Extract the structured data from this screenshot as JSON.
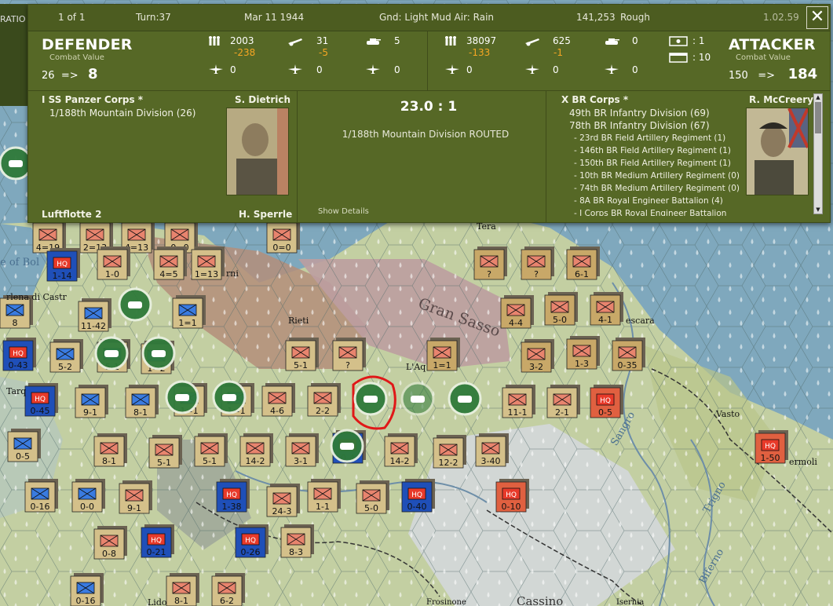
{
  "topbar": {
    "page": "1 of 1",
    "turn": "Turn:37",
    "date": "Mar 11 1944",
    "weather": "Gnd: Light Mud  Air: Rain",
    "hex_info": "141,253",
    "terrain": "Rough",
    "version": "1.02.59",
    "left_label": "RATIO"
  },
  "defender": {
    "title": "DEFENDER",
    "cv_label": "Combat Value",
    "cv_from": "26",
    "cv_arrow": "=>",
    "cv_to": "8",
    "men": "2003",
    "men_loss": "-238",
    "guns": "31",
    "guns_loss": "-5",
    "afv": "5",
    "air1": "0",
    "air2": "0",
    "air3": "0"
  },
  "attacker": {
    "title": "ATTACKER",
    "cv_label": "Combat Value",
    "cv_from": "150",
    "cv_arrow": "=>",
    "cv_to": "184",
    "men": "38097",
    "men_loss": "-133",
    "guns": "625",
    "guns_loss": "-1",
    "afv": "0",
    "air1": "0",
    "air2": "0",
    "air3": "0"
  },
  "modifiers": {
    "m1": ": 1",
    "m2": ": 10"
  },
  "battle": {
    "ratio": "23.0 : 1",
    "result": "1/188th Mountain Division ROUTED",
    "show_details": "Show Details"
  },
  "defender_side": {
    "corps": "I SS Panzer Corps *",
    "leader": "S. Dietrich",
    "units": [
      "1/188th Mountain Division (26)"
    ],
    "air": "Luftflotte 2",
    "air_leader": "H. Sperrle"
  },
  "attacker_side": {
    "corps": "X BR Corps *",
    "leader": "R. McCreery",
    "divisions": [
      "49th BR Infantry Division (69)",
      "78th BR Infantry Division (67)"
    ],
    "support": [
      "- 23rd BR Field Artillery Regiment (1)",
      "- 146th BR Field Artillery Regiment (1)",
      "- 150th BR Field Artillery Regiment (1)",
      "- 10th BR Medium Artillery Regiment (0)",
      "- 74th BR Medium Artillery Regiment (0)",
      "- 8A BR Royal Engineer Battalion (4)",
      "- I Corps BR Royal Engineer Battalion"
    ]
  },
  "map_labels": {
    "rieti": "Rieti",
    "gran_sasso": "Gran Sasso",
    "laq": "L'Aq",
    "pescara": "escara",
    "vasto": "Vasto",
    "termoli": "ermoli",
    "cassino": "Cassino",
    "frosinone": "Frosinone",
    "isernia": "Isernia",
    "sangro": "Sangro",
    "trigno": "Trigno",
    "biferno": "Biferno",
    "bolsena": "e of Bol",
    "orlena": "rlena di Castr",
    "tera": "Tera",
    "tarq": "Tarq",
    "rni": "rni",
    "lido": "Lido"
  },
  "units": [
    {
      "t": "x",
      "n": "4=19"
    },
    {
      "t": "x",
      "n": "2=13"
    },
    {
      "t": "x",
      "n": "4=13"
    },
    {
      "t": "x",
      "n": "0=0"
    },
    {
      "t": "x",
      "n": "0=0"
    },
    {
      "t": "hq",
      "n": "1-14"
    },
    {
      "t": "x",
      "n": "1-0"
    },
    {
      "t": "x",
      "n": "4=5"
    },
    {
      "t": "x",
      "n": "1=13"
    },
    {
      "t": "x",
      "n": "11-42"
    },
    {
      "t": "x",
      "n": "1=1"
    },
    {
      "t": "x",
      "n": "8"
    },
    {
      "t": "hq",
      "n": "0-43"
    },
    {
      "t": "x",
      "n": "5-2"
    },
    {
      "t": "x",
      "n": "5-1"
    },
    {
      "t": "x",
      "n": "1=2"
    },
    {
      "t": "x",
      "n": "5-1"
    },
    {
      "t": "x",
      "n": "?"
    },
    {
      "t": "x",
      "n": "1=1"
    },
    {
      "t": "hq",
      "n": "0-45"
    },
    {
      "t": "x",
      "n": "9-1"
    },
    {
      "t": "x",
      "n": "8-1"
    },
    {
      "t": "x",
      "n": "1=1"
    },
    {
      "t": "x",
      "n": "1=1"
    },
    {
      "t": "x",
      "n": "4-6"
    },
    {
      "t": "x",
      "n": "2-2"
    },
    {
      "t": "x",
      "n": "11-1"
    },
    {
      "t": "x",
      "n": "2-1"
    },
    {
      "t": "hq",
      "n": "0-5"
    },
    {
      "t": "x",
      "n": "?"
    },
    {
      "t": "x",
      "n": "?"
    },
    {
      "t": "x",
      "n": "6-1"
    },
    {
      "t": "x",
      "n": "4-4"
    },
    {
      "t": "x",
      "n": "5-0"
    },
    {
      "t": "x",
      "n": "4-1"
    },
    {
      "t": "x",
      "n": "3-2"
    },
    {
      "t": "x",
      "n": "1-3"
    },
    {
      "t": "x",
      "n": "0-35"
    },
    {
      "t": "x",
      "n": "0-5"
    },
    {
      "t": "x",
      "n": "8-1"
    },
    {
      "t": "x",
      "n": "5-1"
    },
    {
      "t": "x",
      "n": "5-1"
    },
    {
      "t": "x",
      "n": "14-2"
    },
    {
      "t": "x",
      "n": "3-1"
    },
    {
      "t": "hq",
      "n": "0-4"
    },
    {
      "t": "x",
      "n": "14-2"
    },
    {
      "t": "x",
      "n": "12-2"
    },
    {
      "t": "x",
      "n": "3-40"
    },
    {
      "t": "hq",
      "n": "1-50"
    },
    {
      "t": "x",
      "n": "0-16"
    },
    {
      "t": "x",
      "n": "0-0"
    },
    {
      "t": "x",
      "n": "9-1"
    },
    {
      "t": "hq",
      "n": "1-38"
    },
    {
      "t": "x",
      "n": "24-3"
    },
    {
      "t": "x",
      "n": "1-1"
    },
    {
      "t": "x",
      "n": "5-0"
    },
    {
      "t": "hq",
      "n": "0-40"
    },
    {
      "t": "hq",
      "n": "0-10"
    },
    {
      "t": "x",
      "n": "0-8"
    },
    {
      "t": "hq",
      "n": "0-21"
    },
    {
      "t": "hq",
      "n": "0-26"
    },
    {
      "t": "x",
      "n": "8-3"
    },
    {
      "t": "x",
      "n": "0-16"
    },
    {
      "t": "x",
      "n": "8-1"
    },
    {
      "t": "x",
      "n": "6-2"
    }
  ]
}
